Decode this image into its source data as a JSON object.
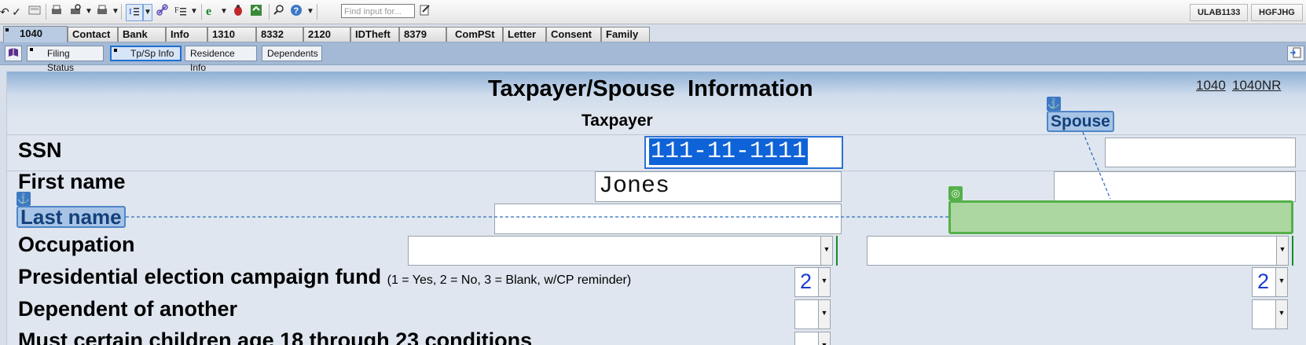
{
  "toolbar": {
    "find_placeholder": "Find input for...",
    "ids": [
      "ULAB1133",
      "HGFJHG"
    ],
    "icons": [
      "undo-icon",
      "check-icon",
      "calculator-icon",
      "print-icon",
      "print-preview-icon",
      "print-options-icon",
      "field-list-icon",
      "link-icon",
      "format-icon",
      "browser-icon",
      "bug-icon",
      "update-icon",
      "search-icon",
      "help-icon",
      "notes-icon"
    ]
  },
  "tabs": [
    "1040",
    "Contact",
    "Bank",
    "Info",
    "1310",
    "8332",
    "2120",
    "IDTheft",
    "8379",
    "ComPSt",
    "Letter",
    "Consent",
    "Family"
  ],
  "active_tab": "1040",
  "subtabs": [
    "Filing Status",
    "Tp/Sp Info",
    "Residence Info",
    "Dependents"
  ],
  "active_subtab": "Tp/Sp Info",
  "form": {
    "title": "Taxpayer/Spouse  Information",
    "links": [
      "1040",
      "1040NR"
    ],
    "taxpayer_header": "Taxpayer",
    "spouse_header": "Spouse",
    "rows": {
      "ssn": "SSN",
      "first_name": "First name",
      "last_name": "Last name",
      "occupation": "Occupation",
      "pecf": "Presidential election campaign fund",
      "pecf_note": "(1 = Yes, 2 = No, 3 = Blank, w/CP reminder)",
      "dependent": "Dependent of another",
      "student": "Must certain children age 18 through 23 conditions"
    },
    "values": {
      "tp_ssn": "111-11-1111",
      "tp_first_name": "Jones",
      "tp_last_name": "",
      "tp_occupation": "",
      "tp_pecf": "2",
      "sp_pecf": "2",
      "tp_dependent": "",
      "sp_dependent": "",
      "sp_ssn": "",
      "sp_first_name": "",
      "sp_occupation": ""
    }
  },
  "colors": {
    "accent": "#1f6fd1",
    "tag_blue": "#a7c4e6",
    "green_field": "#acd7a0"
  }
}
